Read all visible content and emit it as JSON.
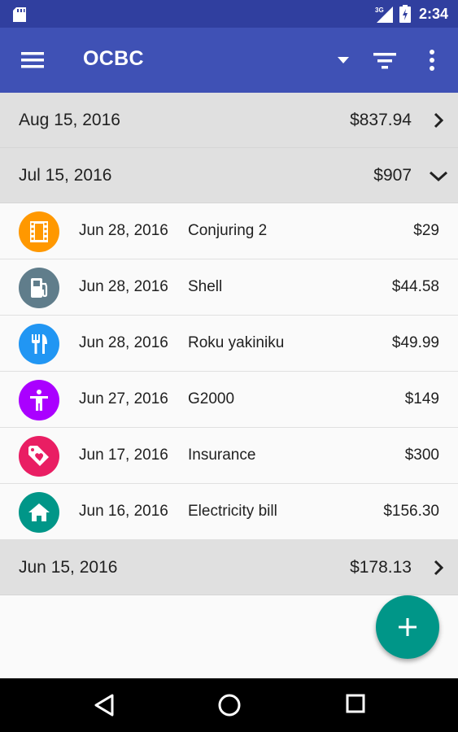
{
  "status_bar": {
    "network": "3G",
    "time": "2:34"
  },
  "app_bar": {
    "title": "OCBC",
    "icons": [
      "menu-icon",
      "dropdown-arrow-icon",
      "filter-icon",
      "more-vert-icon"
    ]
  },
  "groups": [
    {
      "date": "Aug 15, 2016",
      "amount": "$837.94",
      "expanded": false
    },
    {
      "date": "Jul 15, 2016",
      "amount": "$907",
      "expanded": true
    },
    {
      "date": "Jun 15, 2016",
      "amount": "$178.13",
      "expanded": false
    }
  ],
  "transactions": [
    {
      "date": "Jun 28, 2016",
      "payee": "Conjuring 2",
      "amount": "$29",
      "icon": "film-icon",
      "color": "#ff9800"
    },
    {
      "date": "Jun 28, 2016",
      "payee": "Shell",
      "amount": "$44.58",
      "icon": "gas-station-icon",
      "color": "#607d8b"
    },
    {
      "date": "Jun 28, 2016",
      "payee": "Roku yakiniku",
      "amount": "$49.99",
      "icon": "restaurant-icon",
      "color": "#2196f3"
    },
    {
      "date": "Jun 27, 2016",
      "payee": "G2000",
      "amount": "$149",
      "icon": "person-icon",
      "color": "#aa00ff"
    },
    {
      "date": "Jun 17, 2016",
      "payee": "Insurance",
      "amount": "$300",
      "icon": "heart-tag-icon",
      "color": "#e91e63"
    },
    {
      "date": "Jun 16, 2016",
      "payee": "Electricity bill",
      "amount": "$156.30",
      "icon": "home-icon",
      "color": "#009688"
    }
  ],
  "colors": {
    "status_bar": "#303f9f",
    "app_bar": "#3f51b5",
    "group_header": "#e0e0e0",
    "fab": "#009688"
  },
  "fab": {
    "icon": "plus-icon"
  },
  "nav_bar": {
    "icons": [
      "back-icon",
      "home-circle-icon",
      "recents-icon"
    ]
  }
}
